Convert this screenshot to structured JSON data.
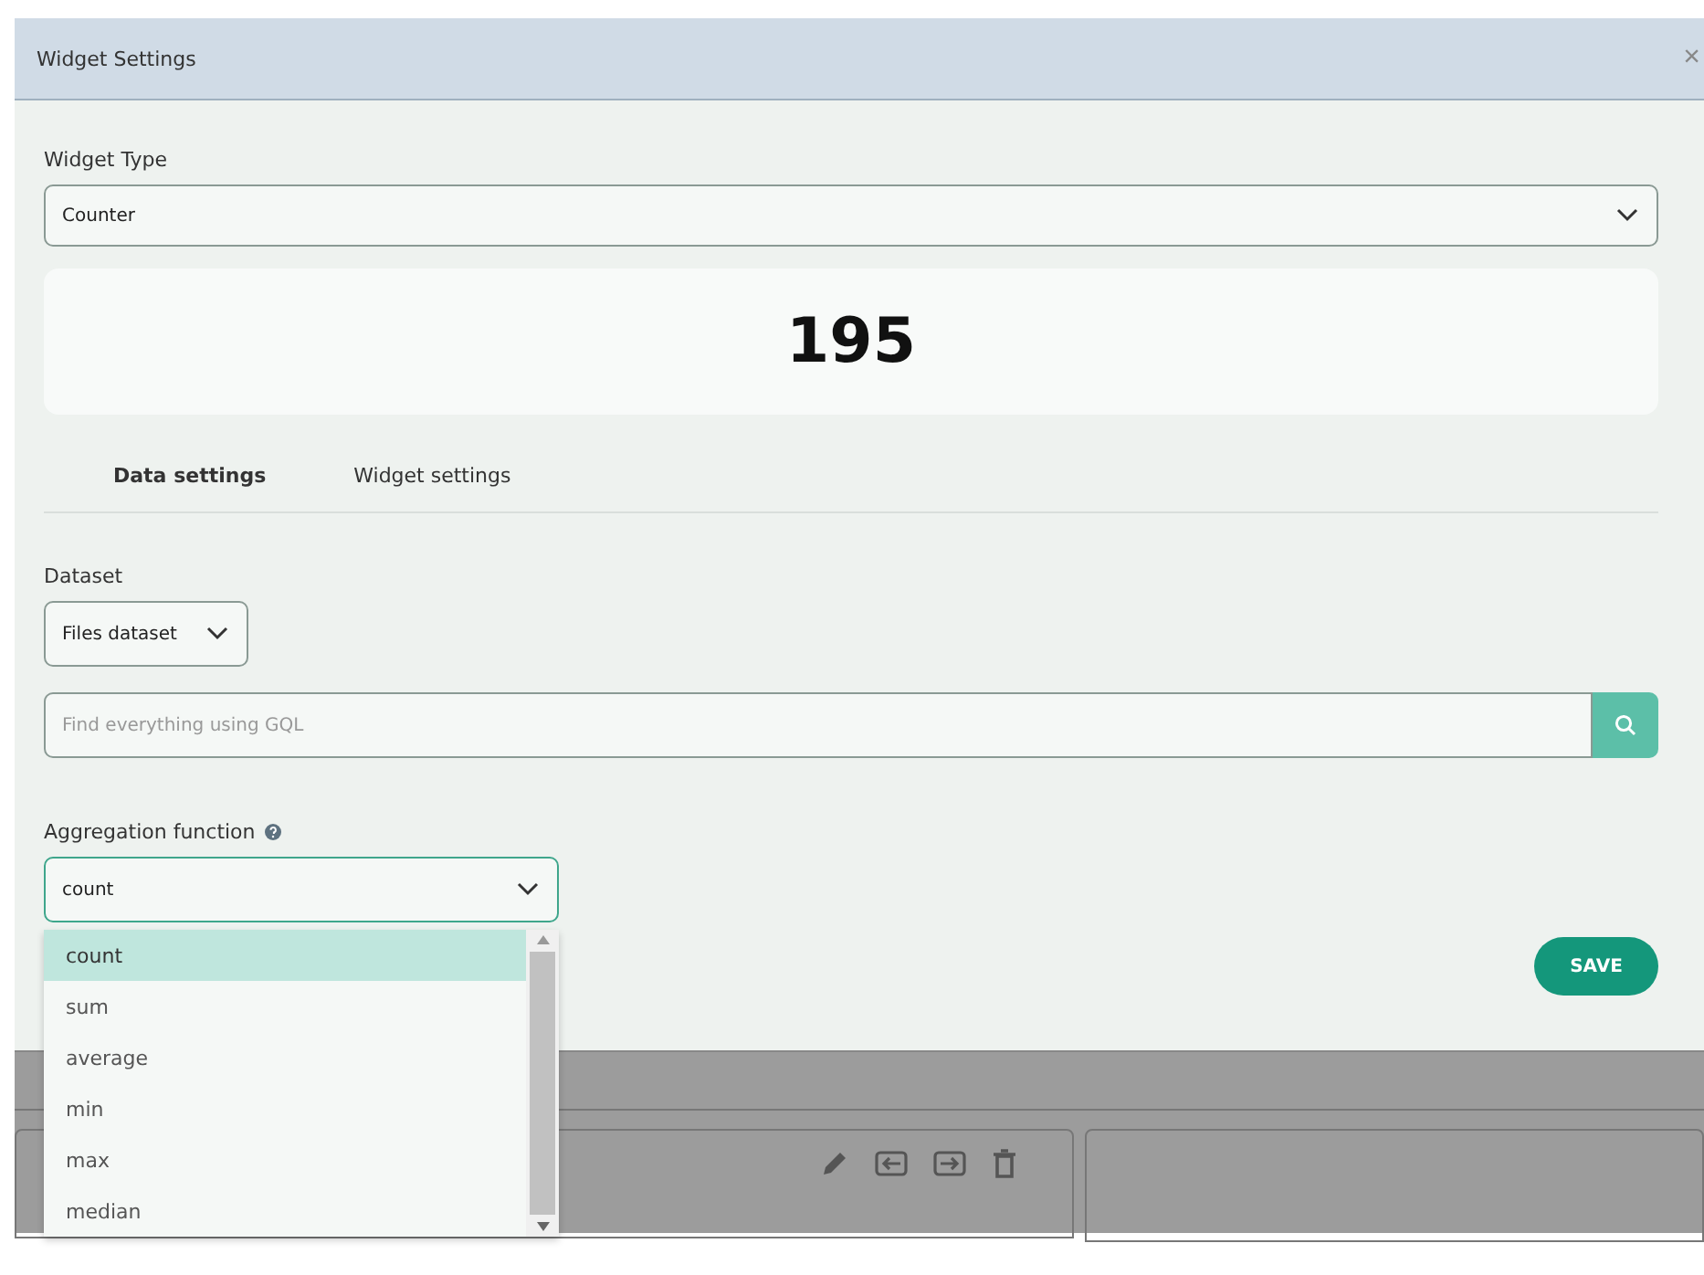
{
  "dialog": {
    "title": "Widget Settings",
    "close": "×"
  },
  "widget_type": {
    "label": "Widget Type",
    "value": "Counter"
  },
  "preview": {
    "value": "195"
  },
  "tabs": [
    {
      "label": "Data settings",
      "selected": true
    },
    {
      "label": "Widget settings",
      "selected": false
    }
  ],
  "dataset": {
    "label": "Dataset",
    "value": "Files dataset"
  },
  "search": {
    "placeholder": "Find everything using GQL"
  },
  "aggregation": {
    "label": "Aggregation function",
    "value": "count",
    "expanded": true,
    "options": [
      {
        "label": "count",
        "selected": true
      },
      {
        "label": "sum",
        "selected": false
      },
      {
        "label": "average",
        "selected": false
      },
      {
        "label": "min",
        "selected": false
      },
      {
        "label": "max",
        "selected": false
      },
      {
        "label": "median",
        "selected": false
      }
    ]
  },
  "save_button": "SAVE"
}
